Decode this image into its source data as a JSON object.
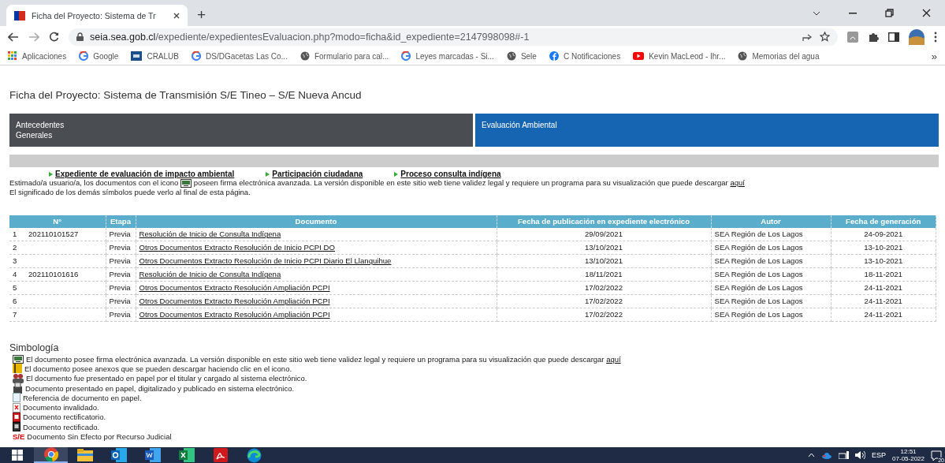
{
  "browser": {
    "tab": {
      "title": "Ficha del Proyecto: Sistema de Tr",
      "selected": true
    },
    "new_tab": "+",
    "address": {
      "host": "seia.sea.gob.cl",
      "path": "/expediente/expedientesEvaluacion.php?modo=ficha&id_expediente=2147998098#-1"
    },
    "bookmarks": [
      {
        "label": "Aplicaciones",
        "kind": "apps"
      },
      {
        "label": "Google",
        "kind": "google"
      },
      {
        "label": "CRALUB",
        "kind": "square"
      },
      {
        "label": "DS/DGacetas Las Co...",
        "kind": "google"
      },
      {
        "label": "Formulario para cal...",
        "kind": "globe"
      },
      {
        "label": "Leyes marcadas - Si...",
        "kind": "google"
      },
      {
        "label": "Sele",
        "kind": "globe"
      },
      {
        "label": "C Notificaciones",
        "kind": "facebook"
      },
      {
        "label": "Kevin MacLeod - Ihr...",
        "kind": "youtube"
      },
      {
        "label": "Memorias del agua",
        "kind": "globe"
      }
    ],
    "bookmarks_more": "»"
  },
  "page": {
    "title": "Ficha del Proyecto: Sistema de Transmisión S/E Tineo – S/E Nueva Ancud",
    "tabs": [
      {
        "label": "Antecedentes Generales",
        "selected": false
      },
      {
        "label": "Evaluación Ambiental",
        "selected": true
      }
    ],
    "links": [
      "Expediente de evaluación de impacto ambiental",
      "Participación ciudadana",
      "Proceso consulta indígena"
    ],
    "notice": {
      "before": "Estimado/a usuario/a, los documentos con el icono",
      "after": "poseen firma electrónica avanzada. La versión disponible en este sitio web tiene validez legal y requiere un programa para su visualización que puede descargar",
      "link": "aquí"
    },
    "notice_2": "El significado de los demás símbolos puede verlo al final de esta página."
  },
  "table": {
    "columns": [
      "N°",
      "Etapa",
      "Documento",
      "Fecha de publicación en expediente electrónico",
      "Autor",
      "Fecha de generación"
    ],
    "rows": [
      {
        "index": "1",
        "number": "202110101527",
        "stage": "Previa",
        "document": "Resolución de Inicio de Consulta Indígena",
        "published": "29/09/2021",
        "author": "SEA Región de Los Lagos",
        "generated": "24-09-2021"
      },
      {
        "index": "2",
        "number": "",
        "stage": "Previa",
        "document": "Otros Documentos Extracto Resolución de Inicio PCPI DO",
        "published": "13/10/2021",
        "author": "SEA Región de Los Lagos",
        "generated": "13-10-2021"
      },
      {
        "index": "3",
        "number": "",
        "stage": "Previa",
        "document": "Otros Documentos Extracto Resolución de Inicio PCPI Diario El Llanquihue",
        "published": "13/10/2021",
        "author": "SEA Región de Los Lagos",
        "generated": "13-10-2021"
      },
      {
        "index": "4",
        "number": "202110101616",
        "stage": "Previa",
        "document": "Resolución de Inicio de Consulta Indígena",
        "published": "18/11/2021",
        "author": "SEA Región de Los Lagos",
        "generated": "18-11-2021"
      },
      {
        "index": "5",
        "number": "",
        "stage": "Previa",
        "document": "Otros Documentos Extracto Resolución Ampliación PCPI",
        "published": "17/02/2022",
        "author": "SEA Región de Los Lagos",
        "generated": "24-11-2021"
      },
      {
        "index": "6",
        "number": "",
        "stage": "Previa",
        "document": "Otros Documentos Extracto Resolución Ampliación PCPI",
        "published": "17/02/2022",
        "author": "SEA Región de Los Lagos",
        "generated": "24-11-2021"
      },
      {
        "index": "7",
        "number": "",
        "stage": "Previa",
        "document": "Otros Documentos Extracto Resolución Ampliación PCPI",
        "published": "17/02/2022",
        "author": "SEA Región de Los Lagos",
        "generated": "24-11-2021"
      }
    ]
  },
  "legend": {
    "title": "Simbología",
    "items": [
      {
        "kind": "signed",
        "text": "El documento posee firma electrónica avanzada. La versión disponible en este sitio web tiene validez legal y requiere un programa para su visualización que puede descargar",
        "link": "aquí"
      },
      {
        "kind": "annex",
        "text": "El documento posee anexos que se pueden descargar haciendo clic en el icono."
      },
      {
        "kind": "paper_owner",
        "text": "El documento fue presentado en papel por el titular y cargado al sistema electrónico."
      },
      {
        "kind": "paper_digital",
        "text": "Documento presentado en papel, digitalizado y publicado en sistema electrónico."
      },
      {
        "kind": "reference",
        "text": "Referencia de documento en papel."
      },
      {
        "kind": "invalid",
        "text": "Documento invalidado."
      },
      {
        "kind": "rectifying",
        "text": "Documento rectificatorio."
      },
      {
        "kind": "rectified",
        "text": "Documento rectificado."
      },
      {
        "kind": "void",
        "mark": "S/E",
        "text": "Documento Sin Efecto por Recurso Judicial"
      }
    ]
  },
  "taskbar": {
    "apps": [
      {
        "kind": "chrome",
        "selected": true
      },
      {
        "kind": "explorer",
        "selected": false
      },
      {
        "kind": "outlook",
        "selected": false
      },
      {
        "kind": "word",
        "selected": false
      },
      {
        "kind": "excel",
        "selected": false
      },
      {
        "kind": "acrobat",
        "selected": false
      },
      {
        "kind": "edge",
        "selected": false
      }
    ],
    "language": "ESP",
    "time": "12:51",
    "date": "07-05-2022",
    "notifications": "20"
  }
}
